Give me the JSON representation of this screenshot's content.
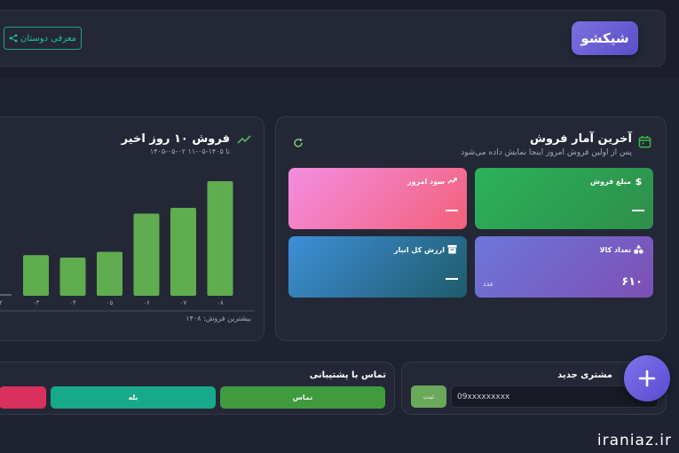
{
  "header": {
    "brand": "شیکشو",
    "referral_label": "معرفی دوستان"
  },
  "stats_card": {
    "title": "آخرین آمار فروش",
    "subtitle": "پس از اولین فروش امروز اینجا نمایش داده می‌شود",
    "tiles": [
      {
        "label": "مبلغ فروش",
        "value": "",
        "icon": "dollar-icon"
      },
      {
        "label": "سود امروز",
        "value": "",
        "icon": "trend-up-icon"
      },
      {
        "label": "تعداد کالا",
        "value": "۶۱۰",
        "unit": "عدد",
        "icon": "shapes-icon"
      },
      {
        "label": "ارزش کل انبار",
        "value": "",
        "icon": "archive-icon"
      }
    ]
  },
  "sales_chart": {
    "title": "فروش ۱۰ روز اخیر",
    "date_range": "۱۴۰۵-۰۵-۰۲ تا ۱۴۰۵-۰۵-۱۱",
    "max_sale": "بیشترین فروش: ۱۴۰۸"
  },
  "chart_data": {
    "type": "bar",
    "title": "فروش ۱۰ روز اخیر",
    "categories": [
      "۰۸",
      "۰۷",
      "۰۶",
      "۰۵",
      "۰۴",
      "۰۳",
      "۰۲"
    ],
    "values": [
      1408,
      1080,
      1010,
      540,
      470,
      500,
      20
    ],
    "ylim": [
      0,
      1408
    ],
    "grid": false,
    "color": "#5fad4e"
  },
  "new_customer": {
    "title": "مشتری جدید",
    "phone_value": "09xxxxxxxxx",
    "submit_label": "ثبت"
  },
  "support": {
    "title": "تماس با پشتیبانی",
    "buttons": [
      "تماس",
      "بله",
      ""
    ]
  },
  "watermark": "iraniaz.ir",
  "colors": {
    "accent": "#6c5fe0",
    "success": "#3f9b3e",
    "teal": "#17a98b",
    "danger": "#d9305e"
  }
}
